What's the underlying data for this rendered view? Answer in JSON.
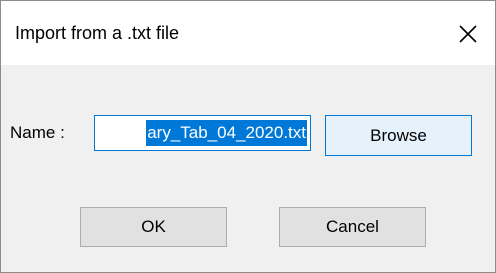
{
  "window": {
    "title": "Import from a .txt file",
    "close_icon": "close-icon"
  },
  "form": {
    "name_label": "Name :",
    "name_value_visible": "ary_Tab_04_2020.txt"
  },
  "buttons": {
    "browse": "Browse",
    "ok": "OK",
    "cancel": "Cancel"
  },
  "colors": {
    "accent": "#0078d7",
    "selection_text": "#ffffff",
    "button_bg": "#e1e1e1",
    "button_hover_bg": "#e5f1fb"
  }
}
